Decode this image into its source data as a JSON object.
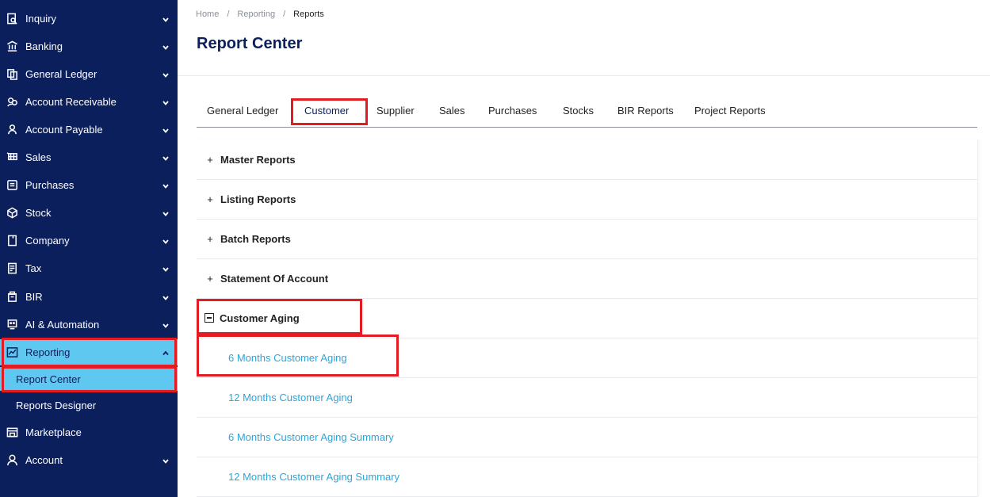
{
  "sidebar": {
    "items": [
      {
        "label": "Inquiry",
        "icon": "search-document-icon"
      },
      {
        "label": "Banking",
        "icon": "bank-icon"
      },
      {
        "label": "General Ledger",
        "icon": "ledger-icon"
      },
      {
        "label": "Account Receivable",
        "icon": "receivable-icon"
      },
      {
        "label": "Account Payable",
        "icon": "payable-icon"
      },
      {
        "label": "Sales",
        "icon": "cart-icon"
      },
      {
        "label": "Purchases",
        "icon": "purchase-icon"
      },
      {
        "label": "Stock",
        "icon": "box-icon"
      },
      {
        "label": "Company",
        "icon": "building-icon"
      },
      {
        "label": "Tax",
        "icon": "tax-icon"
      },
      {
        "label": "BIR",
        "icon": "bir-icon"
      },
      {
        "label": "AI & Automation",
        "icon": "robot-icon"
      },
      {
        "label": "Reporting",
        "icon": "chart-icon"
      }
    ],
    "reporting_sub": [
      "Report Center",
      "Reports Designer"
    ],
    "marketplace": {
      "label": "Marketplace",
      "icon": "store-icon"
    },
    "account": {
      "label": "Account",
      "icon": "user-icon"
    }
  },
  "breadcrumb": [
    "Home",
    "Reporting",
    "Reports"
  ],
  "page_title": "Report Center",
  "tabs": [
    "General Ledger",
    "Customer",
    "Supplier",
    "Sales",
    "Purchases",
    "Stocks",
    "BIR Reports",
    "Project Reports"
  ],
  "active_tab": "Customer",
  "sections": [
    {
      "label": "Master Reports",
      "expanded": false
    },
    {
      "label": "Listing Reports",
      "expanded": false
    },
    {
      "label": "Batch Reports",
      "expanded": false
    },
    {
      "label": "Statement Of Account",
      "expanded": false
    },
    {
      "label": "Customer Aging",
      "expanded": true
    }
  ],
  "aging_reports": [
    "6 Months Customer Aging",
    "12 Months Customer Aging",
    "6 Months Customer Aging Summary",
    "12 Months Customer Aging Summary"
  ],
  "colors": {
    "sidebar": "#0b1f5c",
    "active": "#5ec8f0",
    "link": "#2ba6de",
    "highlight": "#e31b23"
  }
}
